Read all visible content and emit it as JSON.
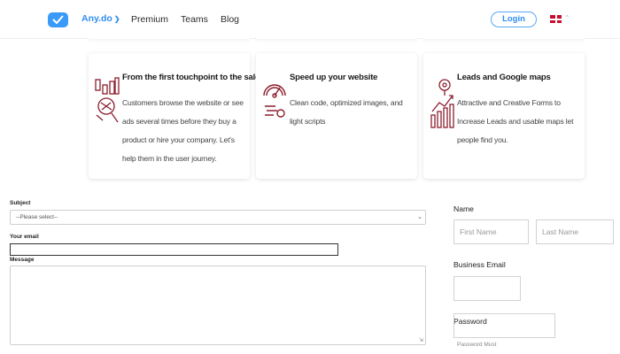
{
  "nav": {
    "brand": "Any.do",
    "links": [
      "Premium",
      "Teams",
      "Blog"
    ],
    "login": "Login",
    "language_icon": "uk-flag-icon",
    "brand_color": "#3b9af7"
  },
  "cards": [
    {
      "title": "From the first touchpoint to the sale",
      "text": "Customers browse the website or see ads several times before they buy a product or hire your company. Let's help them in the user journey.",
      "icon": "sales-funnel-icon"
    },
    {
      "title": "Speed up your website",
      "text": "Clean code, optimized images, and light scripts",
      "icon": "speedometer-icon"
    },
    {
      "title": "Leads and Google maps",
      "text": "Attractive and Creative Forms to Increase Leads and usable maps let people find you.",
      "icon": "leads-growth-icon"
    }
  ],
  "contact_form": {
    "subject_label": "Subject",
    "subject_value": "--Please select--",
    "email_label": "Your email",
    "message_label": "Message"
  },
  "signup_form": {
    "name_label": "Name",
    "first_name_placeholder": "First Name",
    "last_name_placeholder": "Last Name",
    "business_email_label": "Business Email",
    "password_label": "Password",
    "password_hint": "Password Must"
  },
  "accent_color": "#8b1e2d"
}
